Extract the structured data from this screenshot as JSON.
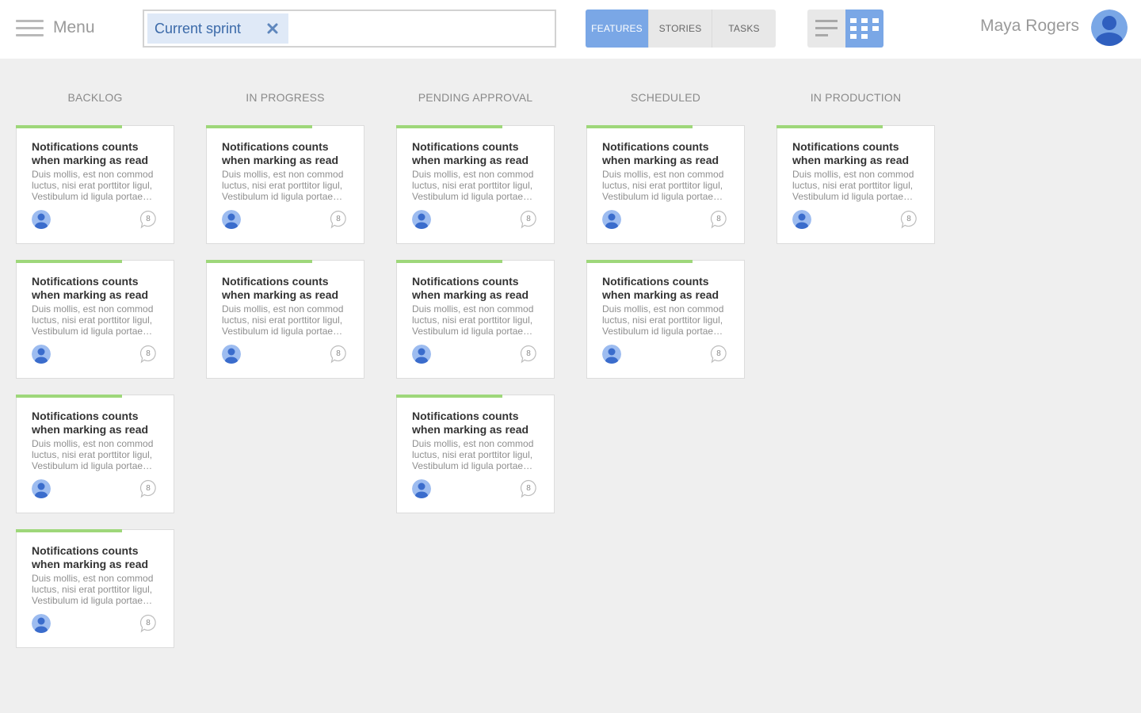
{
  "header": {
    "menu_label": "Menu",
    "filter": {
      "chip_label": "Current sprint"
    },
    "type_tabs": [
      {
        "label": "FEATURES",
        "active": true
      },
      {
        "label": "STORIES",
        "active": false
      },
      {
        "label": "TASKS",
        "active": false
      }
    ],
    "view_modes": [
      {
        "icon": "list-view-icon",
        "active": false
      },
      {
        "icon": "grid-view-icon",
        "active": true
      }
    ],
    "user": {
      "name": "Maya Rogers",
      "icon": "user-avatar-icon"
    }
  },
  "colors": {
    "accent": "#7aa7e6",
    "card_accent": "#9ed77a",
    "background": "#efefef"
  },
  "columns": [
    {
      "title": "BACKLOG",
      "cards": [
        {
          "title": "Notifications counts when marking as read",
          "description": "Duis mollis, est non commod luctus, nisi erat porttitor ligul, Vestibulum id ligula portae…",
          "comments": "8"
        },
        {
          "title": "Notifications counts when marking as read",
          "description": "Duis mollis, est non commod luctus, nisi erat porttitor ligul, Vestibulum id ligula portae…",
          "comments": "8"
        },
        {
          "title": "Notifications counts when marking as read",
          "description": "Duis mollis, est non commod luctus, nisi erat porttitor ligul, Vestibulum id ligula portae…",
          "comments": "8"
        },
        {
          "title": "Notifications counts when marking as read",
          "description": "Duis mollis, est non commod luctus, nisi erat porttitor ligul, Vestibulum id ligula portae…",
          "comments": "8"
        }
      ]
    },
    {
      "title": "IN PROGRESS",
      "cards": [
        {
          "title": "Notifications counts when marking as read",
          "description": "Duis mollis, est non commod luctus, nisi erat porttitor ligul, Vestibulum id ligula portae…",
          "comments": "8"
        },
        {
          "title": "Notifications counts when marking as read",
          "description": "Duis mollis, est non commod luctus, nisi erat porttitor ligul, Vestibulum id ligula portae…",
          "comments": "8"
        }
      ]
    },
    {
      "title": "PENDING APPROVAL",
      "cards": [
        {
          "title": "Notifications counts when marking as read",
          "description": "Duis mollis, est non commod luctus, nisi erat porttitor ligul, Vestibulum id ligula portae…",
          "comments": "8"
        },
        {
          "title": "Notifications counts when marking as read",
          "description": "Duis mollis, est non commod luctus, nisi erat porttitor ligul, Vestibulum id ligula portae…",
          "comments": "8"
        },
        {
          "title": "Notifications counts when marking as read",
          "description": "Duis mollis, est non commod luctus, nisi erat porttitor ligul, Vestibulum id ligula portae…",
          "comments": "8"
        }
      ]
    },
    {
      "title": "SCHEDULED",
      "cards": [
        {
          "title": "Notifications counts when marking as read",
          "description": "Duis mollis, est non commod luctus, nisi erat porttitor ligul, Vestibulum id ligula portae…",
          "comments": "8"
        },
        {
          "title": "Notifications counts when marking as read",
          "description": "Duis mollis, est non commod luctus, nisi erat porttitor ligul, Vestibulum id ligula portae…",
          "comments": "8"
        }
      ]
    },
    {
      "title": "IN PRODUCTION",
      "cards": [
        {
          "title": "Notifications counts when marking as read",
          "description": "Duis mollis, est non commod luctus, nisi erat porttitor ligul, Vestibulum id ligula portae…",
          "comments": "8"
        }
      ]
    }
  ]
}
